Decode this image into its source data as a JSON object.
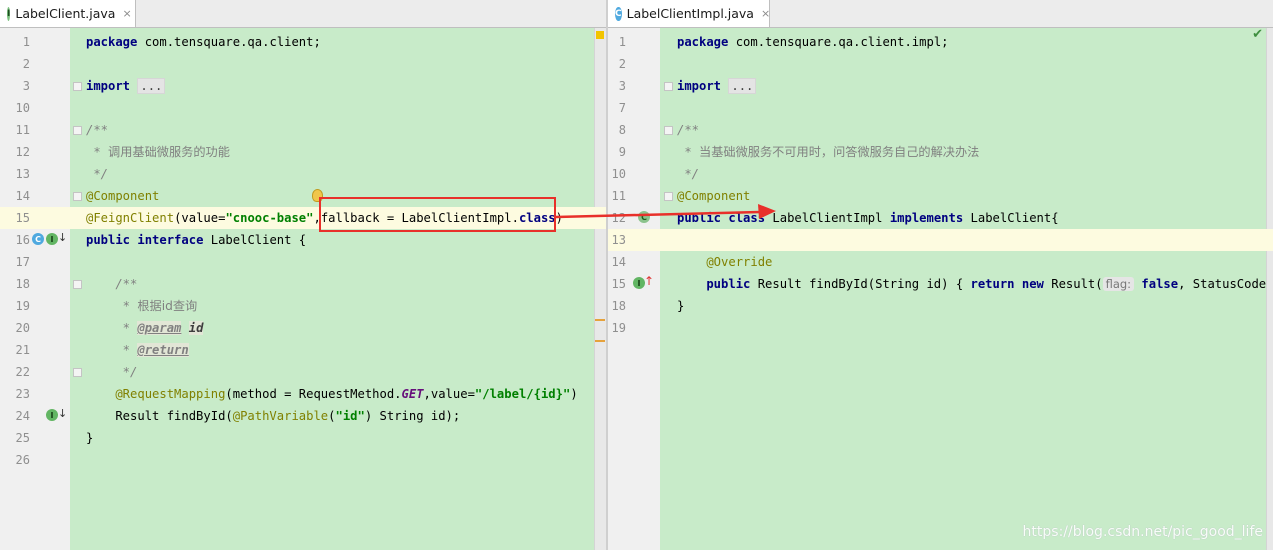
{
  "left_editor": {
    "tab": {
      "icon": "interface-icon",
      "icon_letter": "I",
      "label": "LabelClient.java",
      "close": "×"
    },
    "lines": [
      {
        "n": "1"
      },
      {
        "n": "2"
      },
      {
        "n": "3"
      },
      {
        "n": "10"
      },
      {
        "n": "11"
      },
      {
        "n": "12"
      },
      {
        "n": "13"
      },
      {
        "n": "14"
      },
      {
        "n": "15"
      },
      {
        "n": "16"
      },
      {
        "n": "17"
      },
      {
        "n": "18"
      },
      {
        "n": "19"
      },
      {
        "n": "20"
      },
      {
        "n": "21"
      },
      {
        "n": "22"
      },
      {
        "n": "23"
      },
      {
        "n": "24"
      },
      {
        "n": "25"
      },
      {
        "n": "26"
      }
    ],
    "code": {
      "l1_kw": "package",
      "l1_rest": " com.tensquare.qa.client;",
      "l3_kw": "import",
      "l3_dots": "...",
      "l11": "/**",
      "l12_star": " * ",
      "l12_text": "调用基础微服务的功能",
      "l13": " */",
      "l14": "@Component",
      "l15_ann": "@FeignClient",
      "l15_a": "(value=",
      "l15_str": "\"cnooc-base\"",
      "l15_b": ",fallback = LabelClientImpl.",
      "l15_kw": "class",
      "l15_c": ")",
      "l16_kw1": "public",
      "l16_kw2": "interface",
      "l16_rest": " LabelClient {",
      "l18": "    /**",
      "l19_star": "     * ",
      "l19_text": "根据id查询",
      "l20_star": "     * ",
      "l20_tag": "@param",
      "l20_val": "id",
      "l21_star": "     * ",
      "l21_tag": "@return",
      "l22": "     */",
      "l23_ann": "    @RequestMapping",
      "l23_a": "(method = RequestMethod.",
      "l23_static": "GET",
      "l23_b": ",value=",
      "l23_str": "\"/label/{id}\"",
      "l23_c": ")",
      "l24_a": "    Result findById(",
      "l24_ann": "@PathVariable",
      "l24_b": "(",
      "l24_str": "\"id\"",
      "l24_c": ") String id);",
      "l25": "}"
    }
  },
  "right_editor": {
    "tab": {
      "icon": "class-icon",
      "icon_letter": "C",
      "label": "LabelClientImpl.java",
      "close": "×"
    },
    "lines": [
      {
        "n": "1"
      },
      {
        "n": "2"
      },
      {
        "n": "3"
      },
      {
        "n": "7"
      },
      {
        "n": "8"
      },
      {
        "n": "9"
      },
      {
        "n": "10"
      },
      {
        "n": "11"
      },
      {
        "n": "12"
      },
      {
        "n": "13"
      },
      {
        "n": "14"
      },
      {
        "n": "15"
      },
      {
        "n": "18"
      },
      {
        "n": "19"
      }
    ],
    "code": {
      "l1_kw": "package",
      "l1_rest": " com.tensquare.qa.client.impl;",
      "l3_kw": "import",
      "l3_dots": "...",
      "l8": "/**",
      "l9_star": " * ",
      "l9_text": "当基础微服务不可用时，问答微服务自己的解决办法",
      "l10": " */",
      "l11": "@Component",
      "l12_kw1": "public",
      "l12_kw2": "class",
      "l12_rest": " LabelClientImpl ",
      "l12_kw3": "implements",
      "l12_rest2": " LabelClient{",
      "l14": "    @Override",
      "l15_kw": "    public",
      "l15_a": " Result findById(String id) { ",
      "l15_kw2": "return",
      "l15_kw3": " new",
      "l15_b": " Result(",
      "l15_hint": "flag:",
      "l15_kw4": " false",
      "l15_c": ", StatusCode",
      "l18": "}"
    }
  },
  "watermark": "https://blog.csdn.net/pic_good_life",
  "colors": {
    "editor_bg": "#c8ebc9",
    "highlight_box": "#e8302a",
    "keyword": "#000080",
    "annotation": "#808000",
    "string": "#008000"
  }
}
